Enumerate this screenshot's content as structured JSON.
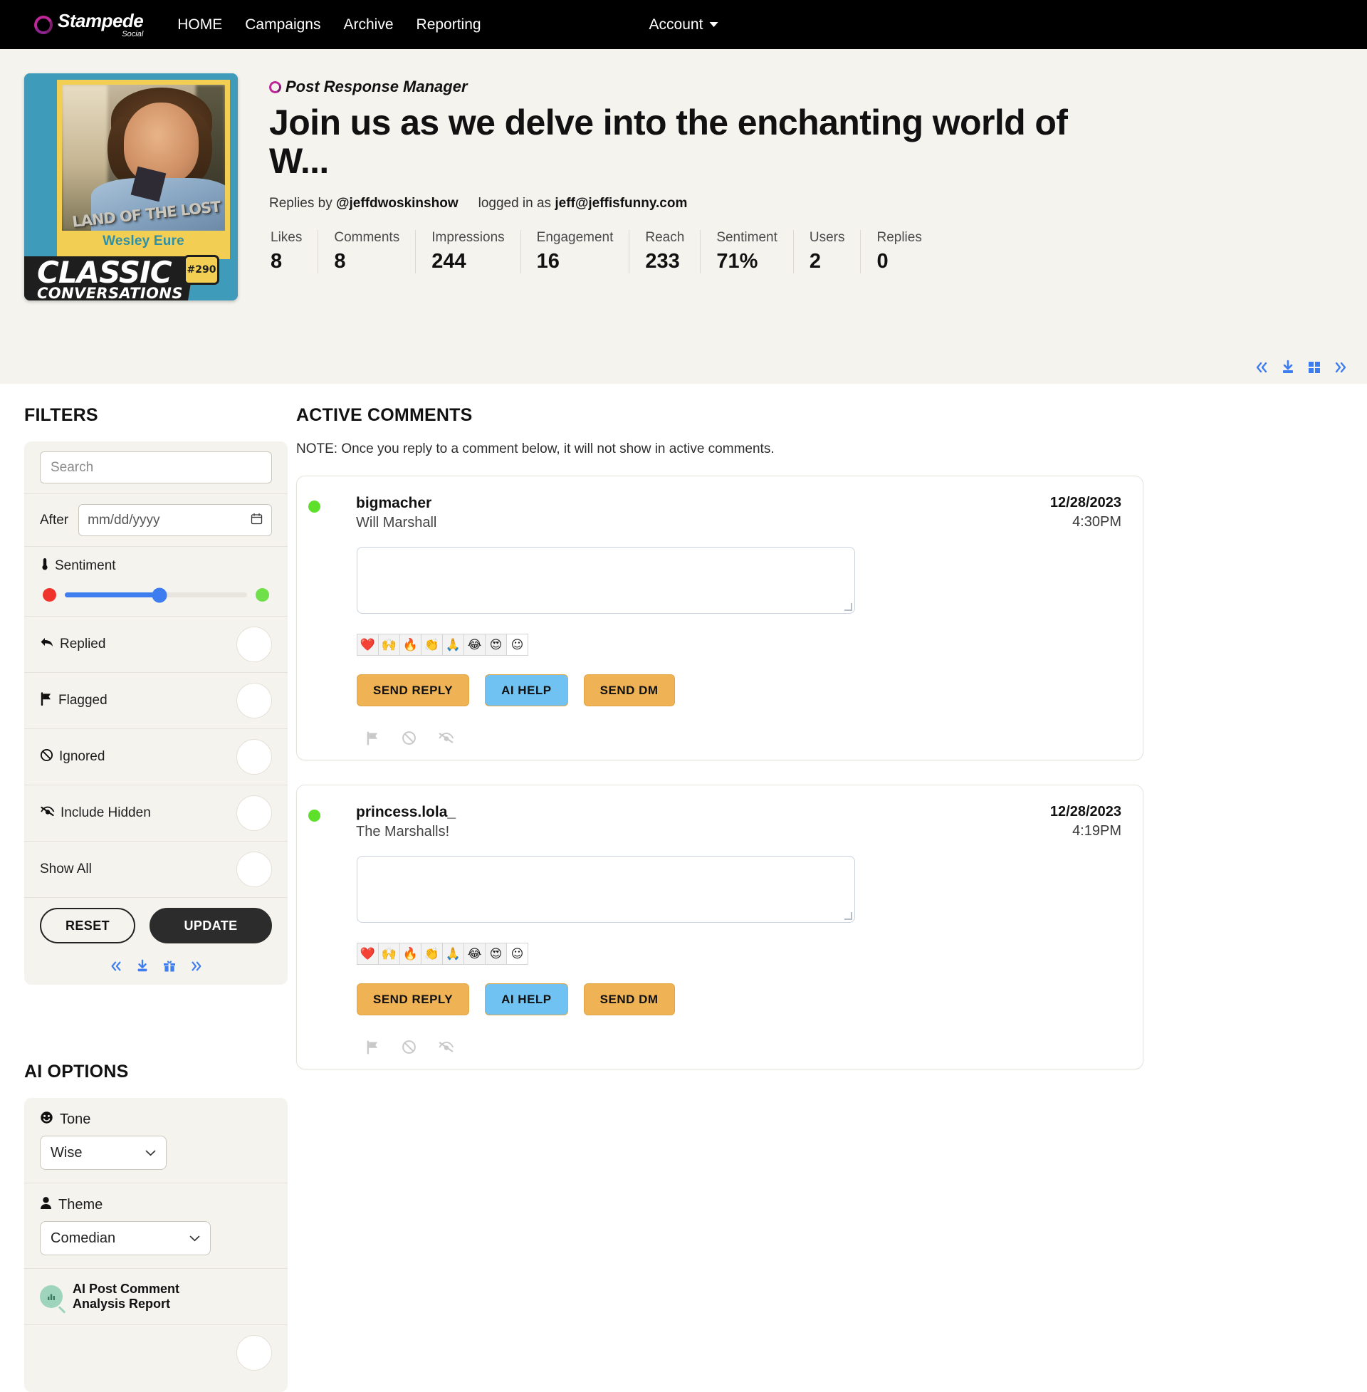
{
  "nav": {
    "brand_name": "Stampede",
    "brand_sub": "Social",
    "links": [
      "HOME",
      "Campaigns",
      "Archive",
      "Reporting"
    ],
    "account_label": "Account"
  },
  "post": {
    "app_label": "Post Response Manager",
    "title": "Join us as we delve into the enchanting world of W...",
    "replies_by_prefix": "Replies by",
    "replies_by_handle": "@jeffdwoskinshow",
    "logged_in_prefix": "logged in as",
    "logged_in_email": "jeff@jeffisfunny.com",
    "thumb": {
      "guest_name": "Wesley Eure",
      "show_logo": "LAND OF THE LOST",
      "series_line1": "CLASSIC",
      "series_line2": "CONVERSATIONS",
      "episode_badge": "#290"
    },
    "stats": [
      {
        "label": "Likes",
        "value": "8"
      },
      {
        "label": "Comments",
        "value": "8"
      },
      {
        "label": "Impressions",
        "value": "244"
      },
      {
        "label": "Engagement",
        "value": "16"
      },
      {
        "label": "Reach",
        "value": "233"
      },
      {
        "label": "Sentiment",
        "value": "71%"
      },
      {
        "label": "Users",
        "value": "2"
      },
      {
        "label": "Replies",
        "value": "0"
      }
    ]
  },
  "header_tools": [
    "first-page-icon",
    "download-icon",
    "grid-view-icon",
    "last-page-icon"
  ],
  "filters": {
    "title": "FILTERS",
    "search_placeholder": "Search",
    "search_value": "",
    "after_label": "After",
    "after_placeholder": "mm/dd/yyyy",
    "sentiment_label": "Sentiment",
    "sentiment_min_icon": "red-dot",
    "sentiment_max_icon": "green-dot",
    "sentiment_value_percent": 52,
    "toggles": [
      {
        "label": "Replied",
        "icon": "reply-arrow-icon",
        "on": false
      },
      {
        "label": "Flagged",
        "icon": "flag-icon",
        "on": false
      },
      {
        "label": "Ignored",
        "icon": "block-icon",
        "on": false
      },
      {
        "label": "Include Hidden",
        "icon": "eye-slash-icon",
        "on": false
      },
      {
        "label": "Show All",
        "icon": "",
        "on": false
      }
    ],
    "reset_label": "RESET",
    "update_label": "UPDATE",
    "mini_tools": [
      "first-page-icon",
      "download-icon",
      "gift-icon",
      "last-page-icon"
    ]
  },
  "ai_options": {
    "title": "AI OPTIONS",
    "tone_label": "Tone",
    "tone_value": "Wise",
    "theme_label": "Theme",
    "theme_value": "Comedian",
    "report_label_line1": "AI Post Comment",
    "report_label_line2": "Analysis Report"
  },
  "comments": {
    "title": "ACTIVE COMMENTS",
    "note": "NOTE: Once you reply to a comment below, it will not show in active comments.",
    "emoji_palette": [
      "❤️",
      "🙌",
      "🔥",
      "👏",
      "🙏",
      "😂",
      "😍",
      "☺"
    ],
    "actions": {
      "send_reply": "SEND REPLY",
      "ai_help": "AI HELP",
      "send_dm": "SEND DM"
    },
    "foot_icons": [
      "flag-icon",
      "block-icon",
      "hide-icon"
    ],
    "items": [
      {
        "handle": "bigmacher",
        "realname": "Will Marshall",
        "date": "12/28/2023",
        "time": "4:30PM",
        "reply_value": "",
        "status": "green"
      },
      {
        "handle": "princess.lola_",
        "realname": "The Marshalls!",
        "date": "12/28/2023",
        "time": "4:19PM",
        "reply_value": "",
        "status": "green"
      }
    ]
  }
}
